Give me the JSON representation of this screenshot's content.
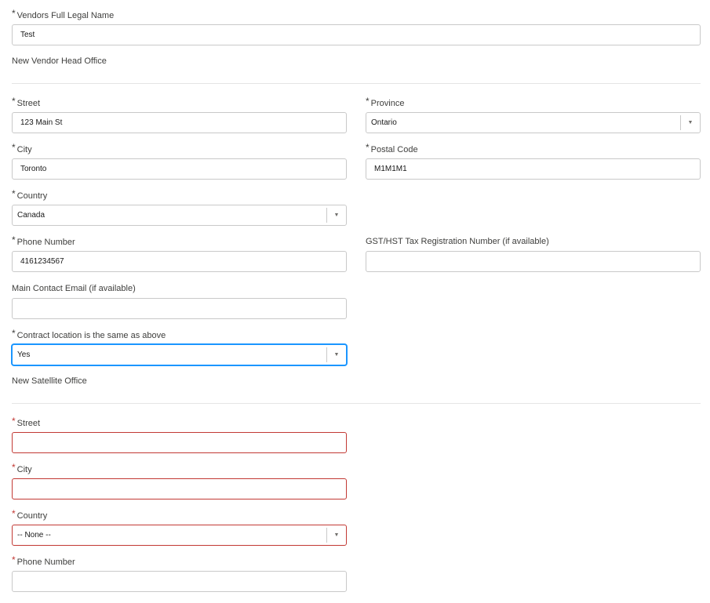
{
  "vendor": {
    "label": "Vendors Full Legal Name",
    "value": "Test"
  },
  "head_office": {
    "title": "New Vendor Head Office",
    "street": {
      "label": "Street",
      "value": "123 Main St"
    },
    "province": {
      "label": "Province",
      "value": "Ontario"
    },
    "city": {
      "label": "City",
      "value": "Toronto"
    },
    "postal": {
      "label": "Postal Code",
      "value": "M1M1M1"
    },
    "country": {
      "label": "Country",
      "value": "Canada"
    },
    "phone": {
      "label": "Phone Number",
      "value": "4161234567"
    },
    "gst": {
      "label": "GST/HST Tax Registration Number (if available)",
      "value": ""
    },
    "email": {
      "label": "Main Contact Email (if available)",
      "value": ""
    },
    "contract": {
      "label": "Contract location is the same as above",
      "value": "Yes"
    }
  },
  "satellite": {
    "title": "New Satellite Office",
    "street": {
      "label": "Street",
      "value": ""
    },
    "city": {
      "label": "City",
      "value": ""
    },
    "country": {
      "label": "Country",
      "value": "-- None --"
    },
    "phone": {
      "label": "Phone Number",
      "value": ""
    }
  },
  "required_marker": "*",
  "dropdown_arrow": "▼"
}
